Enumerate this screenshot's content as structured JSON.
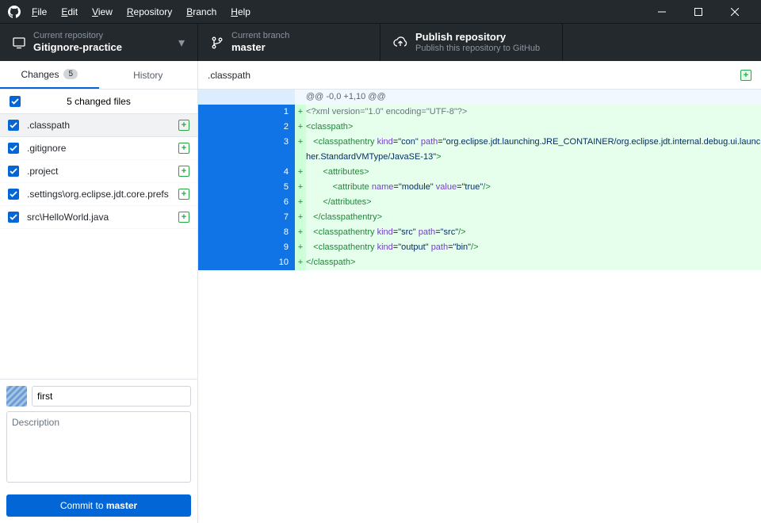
{
  "menu": {
    "file": "File",
    "edit": "Edit",
    "view": "View",
    "repository": "Repository",
    "branch": "Branch",
    "help": "Help"
  },
  "toolbar": {
    "repo_label": "Current repository",
    "repo_value": "Gitignore-practice",
    "branch_label": "Current branch",
    "branch_value": "master",
    "publish_title": "Publish repository",
    "publish_sub": "Publish this repository to GitHub"
  },
  "tabs": {
    "changes": "Changes",
    "changes_count": "5",
    "history": "History"
  },
  "files_header": "5 changed files",
  "files": [
    {
      "name": ".classpath"
    },
    {
      "name": ".gitignore"
    },
    {
      "name": ".project"
    },
    {
      "name": ".settings\\org.eclipse.jdt.core.prefs"
    },
    {
      "name": "src\\HelloWorld.java"
    }
  ],
  "commit": {
    "summary": "first",
    "desc_placeholder": "Description",
    "button_prefix": "Commit to ",
    "button_branch": "master"
  },
  "diff": {
    "filename": ".classpath",
    "hunk": "@@ -0,0 +1,10 @@"
  }
}
